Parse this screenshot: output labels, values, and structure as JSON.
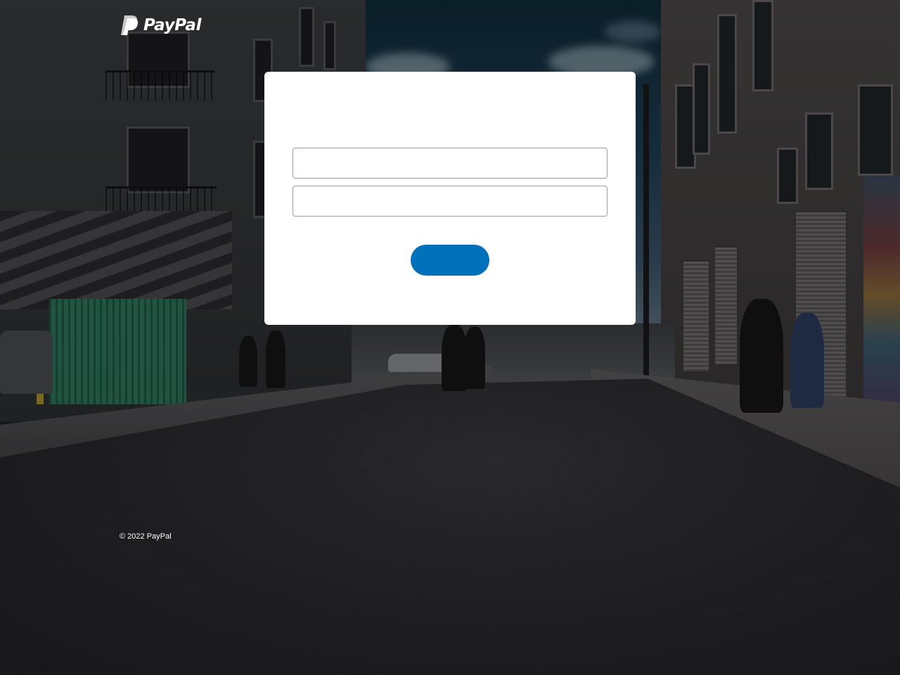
{
  "header": {
    "logo_text": "PayPal",
    "logo_icon": "paypal-p-icon"
  },
  "login_form": {
    "email": {
      "value": "",
      "placeholder": ""
    },
    "password": {
      "value": "",
      "placeholder": ""
    },
    "submit_label": ""
  },
  "footer": {
    "copyright": "© 2022 PayPal"
  },
  "colors": {
    "brand_blue": "#0070ba",
    "card_background": "#ffffff",
    "text_on_dark": "#ffffff"
  }
}
